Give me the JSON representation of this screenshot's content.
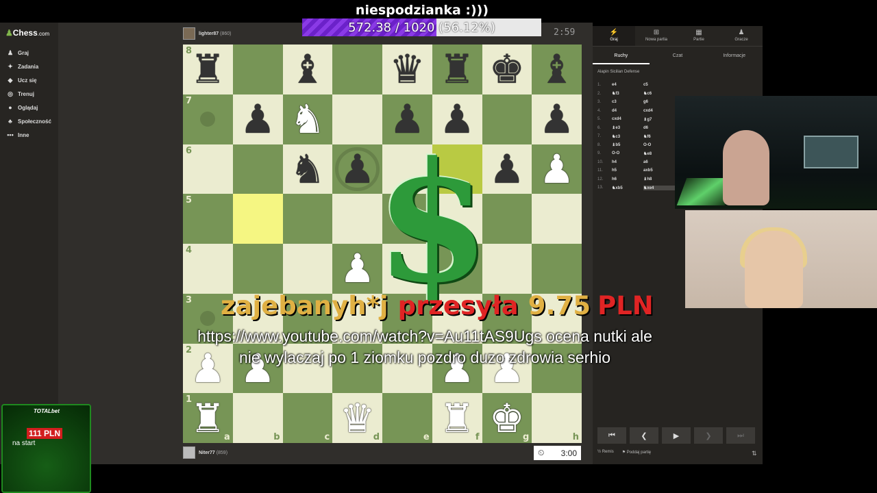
{
  "stream": {
    "goal_title": "niespodzianka :)))",
    "goal_text": "572.38 / 1020 (56.12%)",
    "goal_fraction": 0.5612,
    "donation_user": "zajebanyh*j",
    "donation_action": "przesyła",
    "donation_amount": "9.75",
    "donation_currency": "PLN",
    "donation_message_line1": "https://www.youtube.com/watch?v=Au11tAS9Ugs ocena nutki ale",
    "donation_message_line2": "nie wylaczaj po 1 ziomku pozdro duzo zdrowia serhio",
    "bet_brand": "TOTALbet",
    "bet_bonus": "111 PLN",
    "bet_sub": "na start"
  },
  "sidebar": {
    "logo": "Chess",
    "logo_domain": ".com",
    "items": [
      {
        "label": "Graj",
        "icon": "pawn-icon"
      },
      {
        "label": "Zadania",
        "icon": "puzzle-icon"
      },
      {
        "label": "Ucz się",
        "icon": "graduation-icon"
      },
      {
        "label": "Trenuj",
        "icon": "target-icon"
      },
      {
        "label": "Oglądaj",
        "icon": "binoculars-icon"
      },
      {
        "label": "Społeczność",
        "icon": "people-icon"
      },
      {
        "label": "Inne",
        "icon": "more-icon"
      }
    ]
  },
  "game": {
    "top_player": {
      "name": "lighter87",
      "rating": "(860)",
      "time": "2:59"
    },
    "bottom_player": {
      "name": "Niter77",
      "rating": "(859)",
      "time": "3:00"
    },
    "files": [
      "a",
      "b",
      "c",
      "d",
      "e",
      "f",
      "g",
      "h"
    ],
    "ranks": [
      "8",
      "7",
      "6",
      "5",
      "4",
      "3",
      "2",
      "1"
    ],
    "board": [
      [
        "r",
        "",
        "b",
        "",
        "q",
        "r",
        "k",
        "b"
      ],
      [
        "",
        "p",
        "N",
        "",
        "p",
        "p",
        "",
        "p"
      ],
      [
        "",
        "",
        "n",
        "p",
        "",
        "",
        "p",
        "P"
      ],
      [
        "",
        "",
        "",
        "",
        "",
        "",
        "",
        ""
      ],
      [
        "",
        "",
        "",
        "P",
        "",
        "",
        "",
        ""
      ],
      [
        "",
        "",
        "",
        "",
        "",
        "",
        "",
        ""
      ],
      [
        "P",
        "P",
        "",
        "",
        "",
        "P",
        "P",
        ""
      ],
      [
        "R",
        "",
        "",
        "Q",
        "",
        "R",
        "K",
        ""
      ]
    ],
    "highlights": [
      "b5",
      "f6"
    ],
    "dots": [
      "a7",
      "a3"
    ],
    "rings": [
      "d6"
    ]
  },
  "panel": {
    "tabs": [
      {
        "label": "Graj",
        "icon": "lightning-icon"
      },
      {
        "label": "Nowa partia",
        "icon": "plus-icon"
      },
      {
        "label": "Partie",
        "icon": "grid-icon"
      },
      {
        "label": "Gracze",
        "icon": "players-icon"
      }
    ],
    "subtabs": [
      "Ruchy",
      "Czat",
      "Informacje"
    ],
    "opening": "Alapin Sicilian Defense",
    "moves": [
      {
        "n": "1.",
        "w": "e4",
        "b": "c5"
      },
      {
        "n": "2.",
        "w": "♞f3",
        "b": "♞c6"
      },
      {
        "n": "3.",
        "w": "c3",
        "b": "g6"
      },
      {
        "n": "4.",
        "w": "d4",
        "b": "cxd4"
      },
      {
        "n": "5.",
        "w": "cxd4",
        "b": "♝g7"
      },
      {
        "n": "6.",
        "w": "♝e3",
        "b": "d6"
      },
      {
        "n": "7.",
        "w": "♞c3",
        "b": "♞f6"
      },
      {
        "n": "8.",
        "w": "♝b5",
        "b": "O-O"
      },
      {
        "n": "9.",
        "w": "O-O",
        "b": "♞e8"
      },
      {
        "n": "10.",
        "w": "h4",
        "b": "a6"
      },
      {
        "n": "11.",
        "w": "h5",
        "b": "axb5"
      },
      {
        "n": "12.",
        "w": "h6",
        "b": "♝h8"
      },
      {
        "n": "13.",
        "w": "♞xb5",
        "b": "♞xe4"
      }
    ],
    "draw_label": "Remis",
    "draw_prefix": "½",
    "resign_label": "Poddaj partię"
  }
}
